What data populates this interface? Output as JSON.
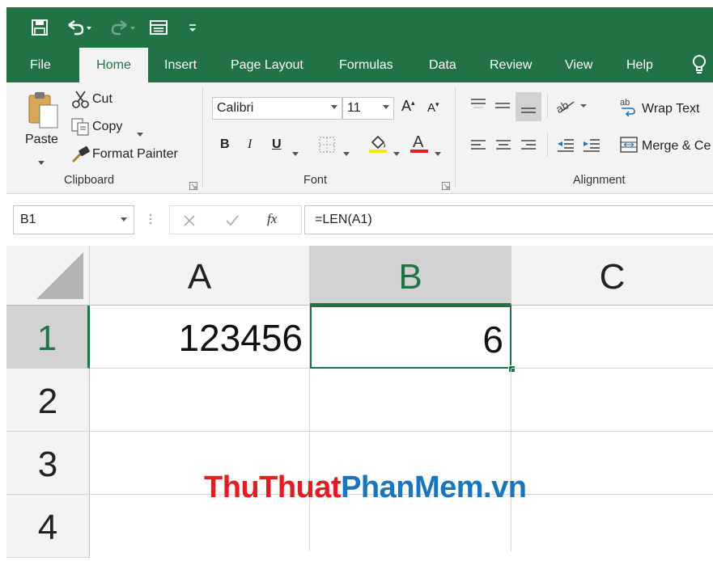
{
  "quick_access": {
    "save_icon": "save-icon",
    "undo_icon": "undo-icon",
    "redo_icon": "redo-icon",
    "form_icon": "form-icon",
    "customize_icon": "customize-icon"
  },
  "tabs": [
    "File",
    "Home",
    "Insert",
    "Page Layout",
    "Formulas",
    "Data",
    "Review",
    "View",
    "Help"
  ],
  "active_tab": "Home",
  "ribbon": {
    "clipboard": {
      "paste": "Paste",
      "cut": "Cut",
      "copy": "Copy",
      "format_painter": "Format Painter",
      "label": "Clipboard"
    },
    "font": {
      "name": "Calibri",
      "size": "11",
      "bold": "B",
      "italic": "I",
      "underline": "U",
      "label": "Font"
    },
    "alignment": {
      "wrap_text": "Wrap Text",
      "merge": "Merge & Ce",
      "label": "Alignment"
    }
  },
  "formula_bar": {
    "name_box": "B1",
    "fx": "fx",
    "formula": "=LEN(A1)"
  },
  "sheet": {
    "columns": [
      "A",
      "B",
      "C"
    ],
    "rows": [
      "1",
      "2",
      "3",
      "4"
    ],
    "cells": {
      "A1": "123456",
      "B1": "6"
    },
    "selected_cell": "B1"
  },
  "watermark": {
    "part1": "ThuThuat",
    "part2": "PhanMem",
    "part3": ".vn"
  },
  "colors": {
    "excel_green": "#217346",
    "watermark_red": "#e31b23",
    "watermark_blue": "#1b75bc"
  }
}
